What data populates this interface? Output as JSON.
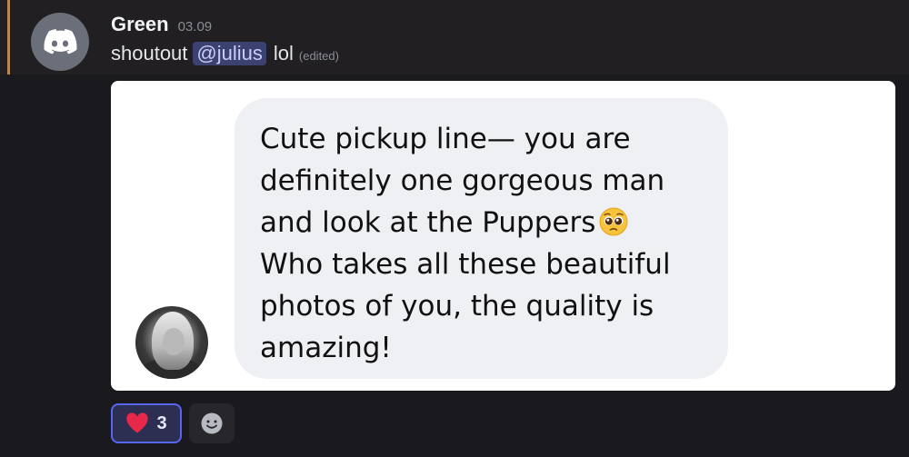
{
  "message": {
    "author": "Green",
    "timestamp": "03.09",
    "content_prefix": "shoutout",
    "mention": "@julius",
    "content_suffix": "lol",
    "edited_label": "(edited)"
  },
  "attachment": {
    "bubble_lines": [
      "Cute pickup line— you are",
      "definitely one gorgeous man",
      "and look at the Puppers",
      "Who takes all these beautiful",
      "photos of you, the quality is",
      "amazing!"
    ],
    "emoji": "pleading-face-emoji"
  },
  "reactions": [
    {
      "icon": "heart-icon",
      "count": "3",
      "active": true
    }
  ],
  "colors": {
    "accent": "#5865f2",
    "highlight_bar": "#b48a52",
    "heart": "#e8284a",
    "mention_bg": "#3c4270"
  }
}
